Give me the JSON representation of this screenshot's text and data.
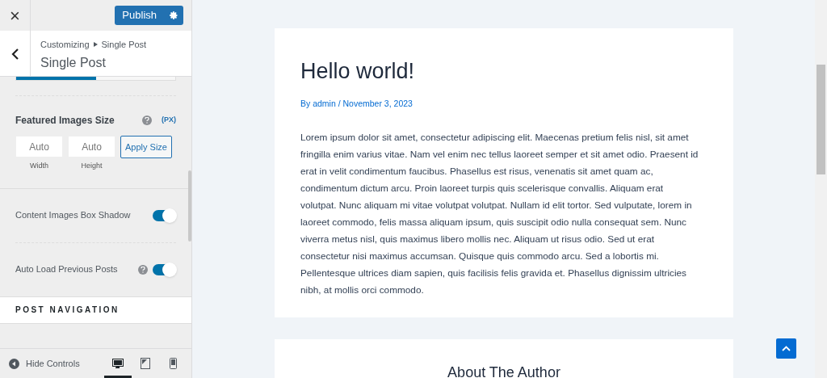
{
  "header": {
    "close": "×",
    "publish": "Publish",
    "breadcrumb": [
      "Customizing",
      "Single Post"
    ],
    "title": "Single Post"
  },
  "tab_bar": {
    "level": 0.5
  },
  "featured_size": {
    "label": "Featured Images Size",
    "unit": "(PX)",
    "fields": [
      {
        "placeholder": "Auto",
        "caption": "Width"
      },
      {
        "placeholder": "Auto",
        "caption": "Height"
      }
    ],
    "button": "Apply Size"
  },
  "toggles": [
    {
      "label": "Content Images Box Shadow",
      "help": false,
      "on": true
    },
    {
      "label": "Auto Load Previous Posts",
      "help": true,
      "on": true
    }
  ],
  "section_heading": "POST NAVIGATION",
  "footer": {
    "hide": "Hide Controls",
    "devices": [
      {
        "kind": "desktop",
        "selected": true
      },
      {
        "kind": "tablet",
        "selected": false
      },
      {
        "kind": "mobile",
        "selected": false
      }
    ]
  },
  "post": {
    "title": "Hello world!",
    "meta": "By admin / November 3, 2023",
    "body": "Lorem ipsum dolor sit amet, consectetur adipiscing elit. Maecenas pretium felis nisl, sit amet fringilla enim varius vitae. Nam vel enim nec tellus laoreet semper et sit amet odio. Praesent id erat in velit condimentum faucibus. Phasellus est risus, venenatis sit amet quam ac, condimentum dictum arcu. Proin laoreet turpis quis scelerisque convallis. Aliquam erat volutpat. Nunc aliquam mi vitae volutpat volutpat. Nullam id elit tortor. Sed vulputate, lorem in laoreet commodo, felis massa aliquam ipsum, quis suscipit odio nulla consequat sem. Nunc viverra metus nisl, quis maximus libero mollis nec. Aliquam ut risus odio. Sed ut erat consectetur nisi maximus accumsan. Quisque quis commodo arcu. Sed a lobortis mi. Pellentesque ultrices diam sapien, quis facilisis felis gravida et. Phasellus dignissim ultricies nibh, at mollis orci commodo."
  },
  "author_heading": "About The Author"
}
